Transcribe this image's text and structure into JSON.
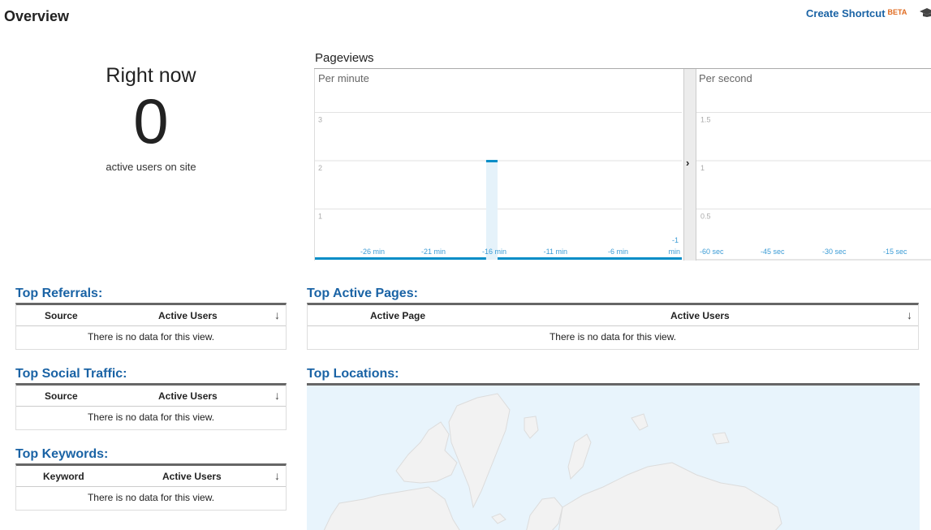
{
  "header": {
    "title": "Overview",
    "shortcut_label": "Create Shortcut",
    "shortcut_badge": "BETA",
    "colors": {
      "link": "#1a63a5",
      "badge": "#e06b20"
    }
  },
  "right_now": {
    "title": "Right now",
    "count": "0",
    "subtitle": "active users on site"
  },
  "pageviews": {
    "title": "Pageviews",
    "per_minute_label": "Per minute",
    "per_second_label": "Per second",
    "toggle_icon": "chevron-right-icon"
  },
  "chart_data": [
    {
      "type": "bar",
      "title": "Pageviews per minute",
      "x": [
        -30,
        -29,
        -28,
        -27,
        -26,
        -25,
        -24,
        -23,
        -22,
        -21,
        -20,
        -19,
        -18,
        -17,
        -16,
        -15,
        -14,
        -13,
        -12,
        -11,
        -10,
        -9,
        -8,
        -7,
        -6,
        -5,
        -4,
        -3,
        -2,
        -1
      ],
      "values": [
        0,
        0,
        0,
        0,
        0,
        0,
        0,
        0,
        0,
        0,
        0,
        0,
        0,
        0,
        2,
        0,
        0,
        0,
        0,
        0,
        0,
        0,
        0,
        0,
        0,
        0,
        0,
        0,
        0,
        0
      ],
      "highlighted_index": 14,
      "x_tick_labels": [
        "-26 min",
        "-21 min",
        "-16 min",
        "-11 min",
        "-6 min",
        "-1 min"
      ],
      "y_ticks": [
        1,
        2,
        3
      ],
      "ylim": [
        0,
        3.9
      ],
      "grid": true,
      "color": "#058dc7"
    },
    {
      "type": "bar",
      "title": "Pageviews per second",
      "x_tick_labels": [
        "-60 sec",
        "-45 sec",
        "-30 sec",
        "-15 sec"
      ],
      "values": [],
      "y_ticks": [
        0.5,
        1,
        1.5
      ],
      "ylim": [
        0,
        1.95
      ],
      "grid": true,
      "color": "#058dc7"
    }
  ],
  "tables": {
    "referrals": {
      "title": "Top Referrals:",
      "col1": "Source",
      "col2": "Active Users",
      "sort_icon": "↓",
      "empty": "There is no data for this view."
    },
    "social": {
      "title": "Top Social Traffic:",
      "col1": "Source",
      "col2": "Active Users",
      "sort_icon": "↓",
      "empty": "There is no data for this view."
    },
    "keywords": {
      "title": "Top Keywords:",
      "col1": "Keyword",
      "col2": "Active Users",
      "sort_icon": "↓",
      "empty": "There is no data for this view."
    },
    "pages": {
      "title": "Top Active Pages:",
      "col1": "Active Page",
      "col2": "Active Users",
      "sort_icon": "↓",
      "empty": "There is no data for this view."
    }
  },
  "locations": {
    "title": "Top Locations:"
  }
}
